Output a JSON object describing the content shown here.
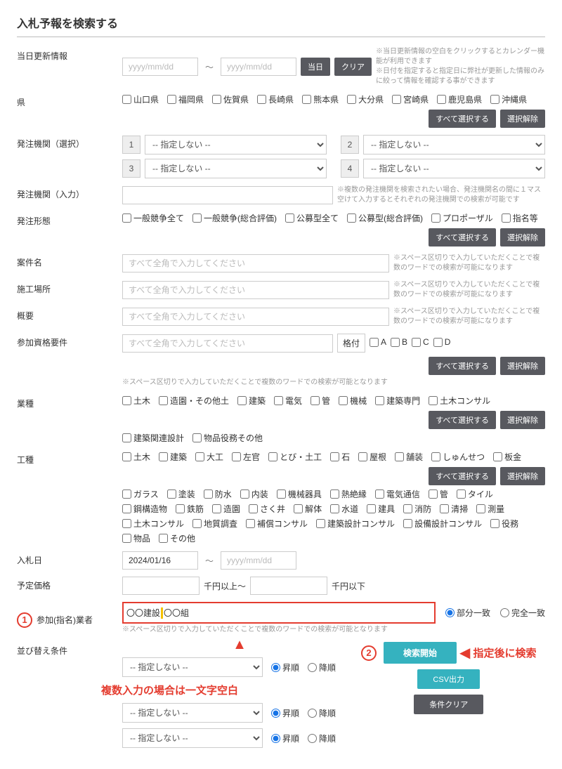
{
  "title": "入札予報を検索する",
  "update": {
    "label": "当日更新情報",
    "placeholder_from": "yyyy/mm/dd",
    "placeholder_to": "yyyy/mm/dd",
    "tilde": "～",
    "btn_today": "当日",
    "btn_clear": "クリア",
    "note1": "当日更新情報の空白をクリックするとカレンダー機能が利用できます",
    "note2": "日付を指定すると指定日に弊社が更新した情報のみに絞って情報を確認する事ができます"
  },
  "pref": {
    "label": "県",
    "items": [
      "山口県",
      "福岡県",
      "佐賀県",
      "長崎県",
      "熊本県",
      "大分県",
      "宮崎県",
      "鹿児島県",
      "沖縄県"
    ],
    "select_all": "すべて選択する",
    "clear": "選択解除"
  },
  "agency_sel": {
    "label": "発注機関（選択）",
    "opt_none": "-- 指定しない --",
    "nums": [
      "1",
      "2",
      "3",
      "4"
    ]
  },
  "agency_in": {
    "label": "発注機関（入力）",
    "note": "複数の発注機関を検索されたい場合、発注機関名の間に１マス空けて入力するとそれぞれの発注機関での検索が可能です"
  },
  "form": {
    "label": "発注形態",
    "items": [
      "一般競争全て",
      "一般競争(総合評価)",
      "公募型全て",
      "公募型(総合評価)",
      "プロポーザル",
      "指名等"
    ],
    "select_all": "すべて選択する",
    "clear": "選択解除"
  },
  "case_name": {
    "label": "案件名",
    "ph": "すべて全角で入力してください",
    "note": "スペース区切りで入力していただくことで複数のワードでの検索が可能になります"
  },
  "site": {
    "label": "施工場所",
    "ph": "すべて全角で入力してください",
    "note": "スペース区切りで入力していただくことで複数のワードでの検索が可能になります"
  },
  "summary": {
    "label": "概要",
    "ph": "すべて全角で入力してください",
    "note": "スペース区切りで入力していただくことで複数のワードでの検索が可能になります"
  },
  "qual": {
    "label": "参加資格要件",
    "ph": "すべて全角で入力してください",
    "grade_label": "格付",
    "grades": [
      "A",
      "B",
      "C",
      "D"
    ],
    "note": "スペース区切りで入力していただくことで複数のワードでの検索が可能となります",
    "select_all": "すべて選択する",
    "clear": "選択解除"
  },
  "industry": {
    "label": "業種",
    "row1": [
      "土木",
      "造園・その他土",
      "建築",
      "電気",
      "管",
      "機械",
      "建築専門",
      "土木コンサル"
    ],
    "row2": [
      "建築関連設計",
      "物品役務その他"
    ],
    "select_all": "すべて選択する",
    "clear": "選択解除"
  },
  "work": {
    "label": "工種",
    "lines": [
      [
        "土木",
        "建築",
        "大工",
        "左官",
        "とび・土工",
        "石",
        "屋根",
        "舗装",
        "しゅんせつ",
        "板金"
      ],
      [
        "ガラス",
        "塗装",
        "防水",
        "内装",
        "機械器具",
        "熱絶縁",
        "電気通信",
        "管",
        "タイル"
      ],
      [
        "鋼構造物",
        "鉄筋",
        "造園",
        "さく井",
        "解体",
        "水道",
        "建具",
        "消防",
        "清掃",
        "測量"
      ],
      [
        "土木コンサル",
        "地質調査",
        "補償コンサル",
        "建築設計コンサル",
        "設備設計コンサル",
        "役務"
      ],
      [
        "物品",
        "その他"
      ]
    ],
    "select_all": "すべて選択する",
    "clear": "選択解除"
  },
  "bid_date": {
    "label": "入札日",
    "from": "2024/01/16",
    "ph_to": "yyyy/mm/dd",
    "tilde": "～"
  },
  "price": {
    "label": "予定価格",
    "mid": "千円以上～",
    "suf": "千円以下"
  },
  "vendor": {
    "label": "参加(指名)業者",
    "value": "〇〇建設　〇〇組",
    "partial": "部分一致",
    "exact": "完全一致",
    "note": "スペース区切りで入力していただくことで複数のワードでの検索が可能となります"
  },
  "sort": {
    "label": "並び替え条件",
    "opt_none": "-- 指定しない --",
    "asc": "昇順",
    "desc": "降順"
  },
  "actions": {
    "search": "検索開始",
    "csv": "CSV出力",
    "clear": "条件クリア"
  },
  "annot": {
    "num1": "1",
    "num2": "2",
    "multi": "複数入力の場合は一文字空白",
    "after": "指定後に検索"
  }
}
